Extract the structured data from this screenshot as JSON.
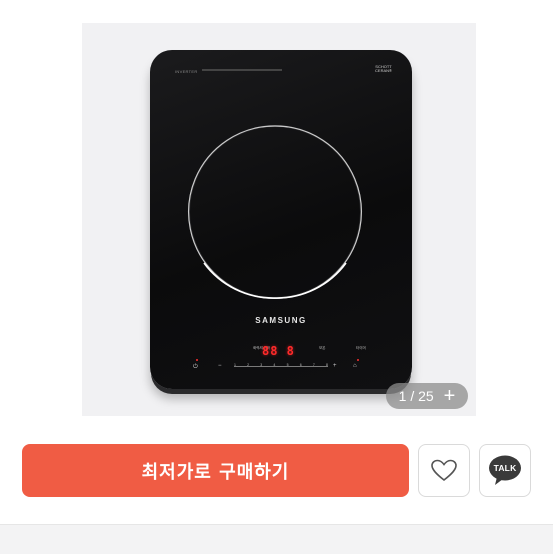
{
  "product_image": {
    "alt_subject": "cooktop-photo",
    "brand_text": "SAMSUNG",
    "inverter_text": "INVERTER",
    "ceran_logo": [
      "SCHOTT",
      "CERAN®"
    ],
    "display_value": "88 8",
    "panel_labels": {
      "left": "화력/타이머",
      "right1": "보온",
      "right2": "타이머"
    },
    "slider_ticks": [
      "1",
      "2",
      "3",
      "4",
      "5",
      "6",
      "7",
      "8"
    ]
  },
  "gallery": {
    "counter_text": "1 / 25",
    "plus_icon": "plus-icon"
  },
  "actions": {
    "buy_label": "최저가로 구매하기",
    "buy_color": "#f05c44",
    "wishlist_icon": "heart-icon",
    "talk_label": "TALK",
    "talk_icon": "kakao-talk-icon"
  }
}
